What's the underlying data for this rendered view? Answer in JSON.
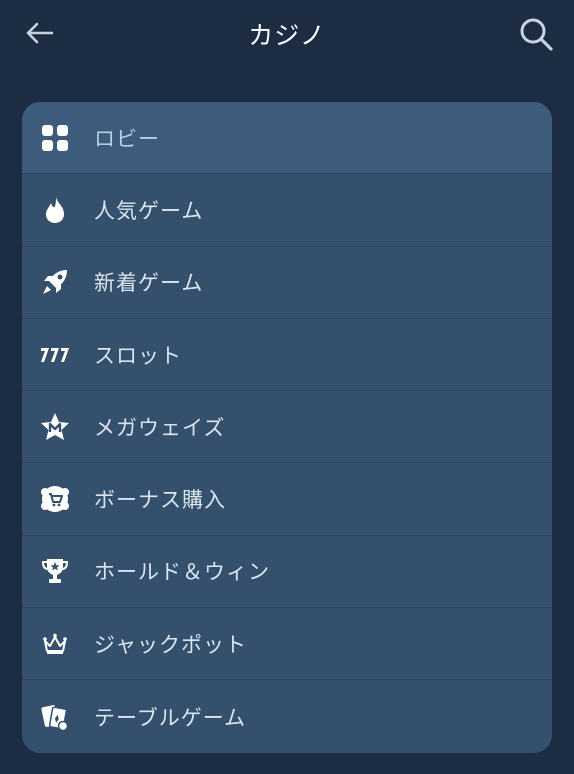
{
  "header": {
    "title": "カジノ",
    "back_icon": "arrow-left-icon",
    "search_icon": "search-icon"
  },
  "menu": {
    "items": [
      {
        "label": "ロビー",
        "icon": "grid-icon",
        "active": true
      },
      {
        "label": "人気ゲーム",
        "icon": "flame-icon"
      },
      {
        "label": "新着ゲーム",
        "icon": "rocket-icon"
      },
      {
        "label": "スロット",
        "icon": "slot-777-icon"
      },
      {
        "label": "メガウェイズ",
        "icon": "megaways-star-icon"
      },
      {
        "label": "ボーナス購入",
        "icon": "bonus-cart-icon"
      },
      {
        "label": "ホールド＆ウィン",
        "icon": "trophy-icon"
      },
      {
        "label": "ジャックポット",
        "icon": "crown-icon"
      },
      {
        "label": "テーブルゲーム",
        "icon": "cards-icon"
      }
    ]
  },
  "colors": {
    "background": "#1c2c42",
    "card": "#34506c",
    "active_row": "#3d5c7c",
    "text": "#dbe4ee"
  }
}
